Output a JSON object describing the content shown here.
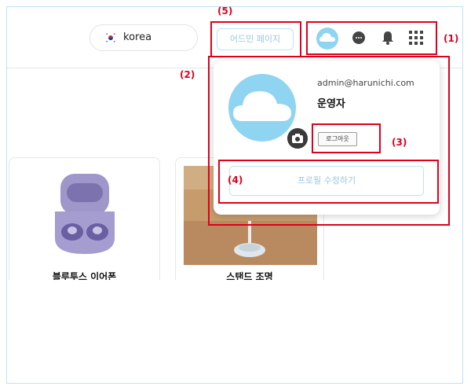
{
  "header": {
    "language": "korea",
    "admin_page_button": "어드민 페이지",
    "icons": [
      "cloud-avatar-icon",
      "chat-icon",
      "bell-icon",
      "apps-grid-icon"
    ]
  },
  "annotations": {
    "a1": "(1)",
    "a2": "(2)",
    "a3": "(3)",
    "a4": "(4)",
    "a5": "(5)"
  },
  "profile_popup": {
    "email": "admin@harunichi.com",
    "role": "운영자",
    "logout_button": "로그아웃",
    "edit_profile_button": "프로필 수정하기"
  },
  "products": [
    {
      "title": "블루투스 이어폰"
    },
    {
      "title": "스탠드 조명"
    }
  ],
  "colors": {
    "accent_border": "#bfe3f2",
    "accent_text": "#9cc7dc",
    "cloud": "#8fd4f0",
    "annotation_red": "#e0001b"
  }
}
